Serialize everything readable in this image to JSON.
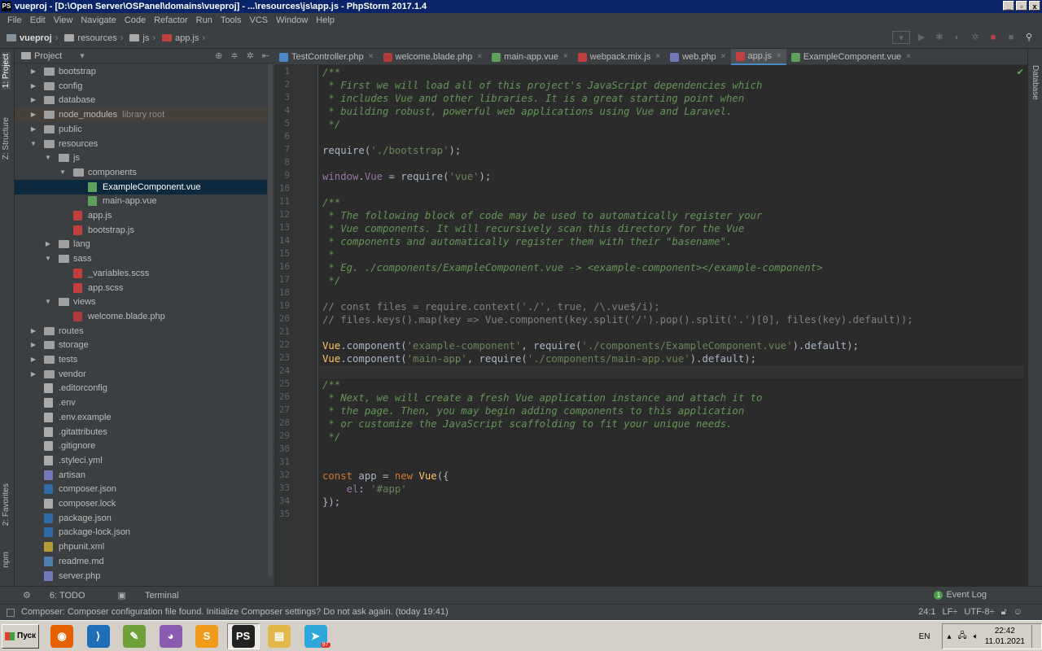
{
  "window": {
    "title": "vueproj - [D:\\Open Server\\OSPanel\\domains\\vueproj] - ...\\resources\\js\\app.js - PhpStorm 2017.1.4",
    "app_icon": "PS",
    "minimize": "_",
    "restore": "▫",
    "close": "x"
  },
  "menu": [
    "File",
    "Edit",
    "View",
    "Navigate",
    "Code",
    "Refactor",
    "Run",
    "Tools",
    "VCS",
    "Window",
    "Help"
  ],
  "breadcrumb": {
    "project": "vueproj",
    "folder1": "resources",
    "folder2": "js",
    "file": "app.js"
  },
  "left_strip": {
    "project": "1: Project",
    "structure": "Z: Structure",
    "favorites": "2: Favorites",
    "npm": "npm"
  },
  "right_strip": {
    "database": "Database"
  },
  "project_panel": {
    "title": "Project",
    "items": [
      {
        "label": "bootstrap",
        "type": "folder",
        "depth": 0,
        "open": false
      },
      {
        "label": "config",
        "type": "folder",
        "depth": 0,
        "open": false
      },
      {
        "label": "database",
        "type": "folder",
        "depth": 0,
        "open": false
      },
      {
        "label": "node_modules",
        "note": "library root",
        "type": "folder",
        "depth": 0,
        "open": false,
        "hl": true
      },
      {
        "label": "public",
        "type": "folder",
        "depth": 0,
        "open": false
      },
      {
        "label": "resources",
        "type": "folder",
        "depth": 0,
        "open": true
      },
      {
        "label": "js",
        "type": "folder",
        "depth": 1,
        "open": true
      },
      {
        "label": "components",
        "type": "folder",
        "depth": 2,
        "open": true
      },
      {
        "label": "ExampleComponent.vue",
        "type": "vue",
        "depth": 3,
        "selected": true
      },
      {
        "label": "main-app.vue",
        "type": "vue",
        "depth": 3
      },
      {
        "label": "app.js",
        "type": "js",
        "depth": 2
      },
      {
        "label": "bootstrap.js",
        "type": "js",
        "depth": 2
      },
      {
        "label": "lang",
        "type": "folder",
        "depth": 1,
        "open": false
      },
      {
        "label": "sass",
        "type": "folder",
        "depth": 1,
        "open": true
      },
      {
        "label": "_variables.scss",
        "type": "scss",
        "depth": 2
      },
      {
        "label": "app.scss",
        "type": "scss",
        "depth": 2
      },
      {
        "label": "views",
        "type": "folder",
        "depth": 1,
        "open": true
      },
      {
        "label": "welcome.blade.php",
        "type": "php",
        "depth": 2
      },
      {
        "label": "routes",
        "type": "folder",
        "depth": 0,
        "open": false
      },
      {
        "label": "storage",
        "type": "folder",
        "depth": 0,
        "open": false
      },
      {
        "label": "tests",
        "type": "folder",
        "depth": 0,
        "open": false
      },
      {
        "label": "vendor",
        "type": "folder",
        "depth": 0,
        "open": false
      },
      {
        "label": ".editorconfig",
        "type": "txt",
        "depth": 0
      },
      {
        "label": ".env",
        "type": "txt",
        "depth": 0
      },
      {
        "label": ".env.example",
        "type": "txt",
        "depth": 0
      },
      {
        "label": ".gitattributes",
        "type": "txt",
        "depth": 0
      },
      {
        "label": ".gitignore",
        "type": "txt",
        "depth": 0
      },
      {
        "label": ".styleci.yml",
        "type": "txt",
        "depth": 0
      },
      {
        "label": "artisan",
        "type": "phpfile",
        "depth": 0
      },
      {
        "label": "composer.json",
        "type": "json",
        "depth": 0
      },
      {
        "label": "composer.lock",
        "type": "txt",
        "depth": 0
      },
      {
        "label": "package.json",
        "type": "json",
        "depth": 0
      },
      {
        "label": "package-lock.json",
        "type": "json",
        "depth": 0
      },
      {
        "label": "phpunit.xml",
        "type": "xml",
        "depth": 0
      },
      {
        "label": "readme.md",
        "type": "md",
        "depth": 0
      },
      {
        "label": "server.php",
        "type": "phpfile",
        "depth": 0
      }
    ]
  },
  "tabs": [
    {
      "label": "TestController.php",
      "color": "#4a88c7"
    },
    {
      "label": "welcome.blade.php",
      "color": "#b03b3b"
    },
    {
      "label": "main-app.vue",
      "color": "#5fa05f"
    },
    {
      "label": "webpack.mix.js",
      "color": "#c04040"
    },
    {
      "label": "web.php",
      "color": "#7179b8"
    },
    {
      "label": "app.js",
      "color": "#c04040",
      "active": true
    },
    {
      "label": "ExampleComponent.vue",
      "color": "#5fa05f"
    }
  ],
  "code_lines": [
    [
      [
        "cm",
        "/**"
      ]
    ],
    [
      [
        "cm",
        " * First we will load all of this project's JavaScript dependencies which"
      ]
    ],
    [
      [
        "cm",
        " * includes Vue and other libraries. It is a great starting point when"
      ]
    ],
    [
      [
        "cm",
        " * building robust, powerful web applications using Vue and Laravel."
      ]
    ],
    [
      [
        "cm",
        " */"
      ]
    ],
    [],
    [
      [
        "pl",
        "require("
      ],
      [
        "str",
        "'./bootstrap'"
      ],
      [
        "pl",
        ");"
      ]
    ],
    [],
    [
      [
        "pr",
        "window"
      ],
      [
        "pl",
        "."
      ],
      [
        "pr",
        "Vue"
      ],
      [
        "pl",
        " = require("
      ],
      [
        "str",
        "'vue'"
      ],
      [
        "pl",
        ");"
      ]
    ],
    [],
    [
      [
        "cm",
        "/**"
      ]
    ],
    [
      [
        "cm",
        " * The following block of code may be used to automatically register your"
      ]
    ],
    [
      [
        "cm",
        " * Vue components. It will recursively scan this directory for the Vue"
      ]
    ],
    [
      [
        "cm",
        " * components and automatically register them with their \"basename\"."
      ]
    ],
    [
      [
        "cm",
        " *"
      ]
    ],
    [
      [
        "cm",
        " * Eg. ./components/ExampleComponent.vue -> <example-component></example-component>"
      ]
    ],
    [
      [
        "cm",
        " */"
      ]
    ],
    [],
    [
      [
        "lc",
        "// const files = require.context('./', true, /\\.vue$/i);"
      ]
    ],
    [
      [
        "lc",
        "// files.keys().map(key => Vue.component(key.split('/').pop().split('.')[0], files(key).default));"
      ]
    ],
    [],
    [
      [
        "fn",
        "Vue"
      ],
      [
        "pl",
        ".component("
      ],
      [
        "str",
        "'example-component'"
      ],
      [
        "pl",
        ", require("
      ],
      [
        "str",
        "'./components/ExampleComponent.vue'"
      ],
      [
        "pl",
        ").default);"
      ]
    ],
    [
      [
        "fn",
        "Vue"
      ],
      [
        "pl",
        ".component("
      ],
      [
        "str",
        "'main-app'"
      ],
      [
        "pl",
        ", require("
      ],
      [
        "str",
        "'./components/main-app.vue'"
      ],
      [
        "pl",
        ").default);"
      ]
    ],
    [],
    [
      [
        "cm",
        "/**"
      ]
    ],
    [
      [
        "cm",
        " * Next, we will create a fresh Vue application instance and attach it to"
      ]
    ],
    [
      [
        "cm",
        " * the page. Then, you may begin adding components to this application"
      ]
    ],
    [
      [
        "cm",
        " * or customize the JavaScript scaffolding to fit your unique needs."
      ]
    ],
    [
      [
        "cm",
        " */"
      ]
    ],
    [],
    [],
    [
      [
        "kw",
        "const "
      ],
      [
        "pl",
        "app = "
      ],
      [
        "kw",
        "new "
      ],
      [
        "fn",
        "Vue"
      ],
      [
        "pl",
        "({"
      ]
    ],
    [
      [
        "pr",
        "    el"
      ],
      [
        "pl",
        ": "
      ],
      [
        "str",
        "'#app'"
      ]
    ],
    [
      [
        "pl",
        "});"
      ]
    ],
    []
  ],
  "current_line": 24,
  "bottom_tabs": {
    "todo": "6: TODO",
    "terminal": "Terminal",
    "event_log": "Event Log",
    "event_count": "1"
  },
  "status": {
    "message": "Composer: Composer configuration file found. Initialize Composer settings? Do not ask again. (today 19:41)",
    "position": "24:1",
    "line_sep": "LF÷",
    "encoding": "UTF-8÷"
  },
  "taskbar": {
    "start": "Пуск",
    "lang": "EN",
    "time": "22:42",
    "date": "11.01.2021",
    "apps": [
      {
        "name": "firefox",
        "color": "#e66000",
        "glyph": "◉"
      },
      {
        "name": "vscode",
        "color": "#1f6fb8",
        "glyph": "⟩"
      },
      {
        "name": "notepad",
        "color": "#6fa03a",
        "glyph": "✎"
      },
      {
        "name": "github",
        "color": "#8a5bb0",
        "glyph": "◕"
      },
      {
        "name": "sublime",
        "color": "#ef9a1a",
        "glyph": "S"
      },
      {
        "name": "phpstorm",
        "color": "#222222",
        "glyph": "PS",
        "active": true
      },
      {
        "name": "explorer",
        "color": "#e2b84a",
        "glyph": "▤"
      },
      {
        "name": "telegram",
        "color": "#2ea6da",
        "glyph": "➤",
        "badge": "97"
      }
    ]
  }
}
